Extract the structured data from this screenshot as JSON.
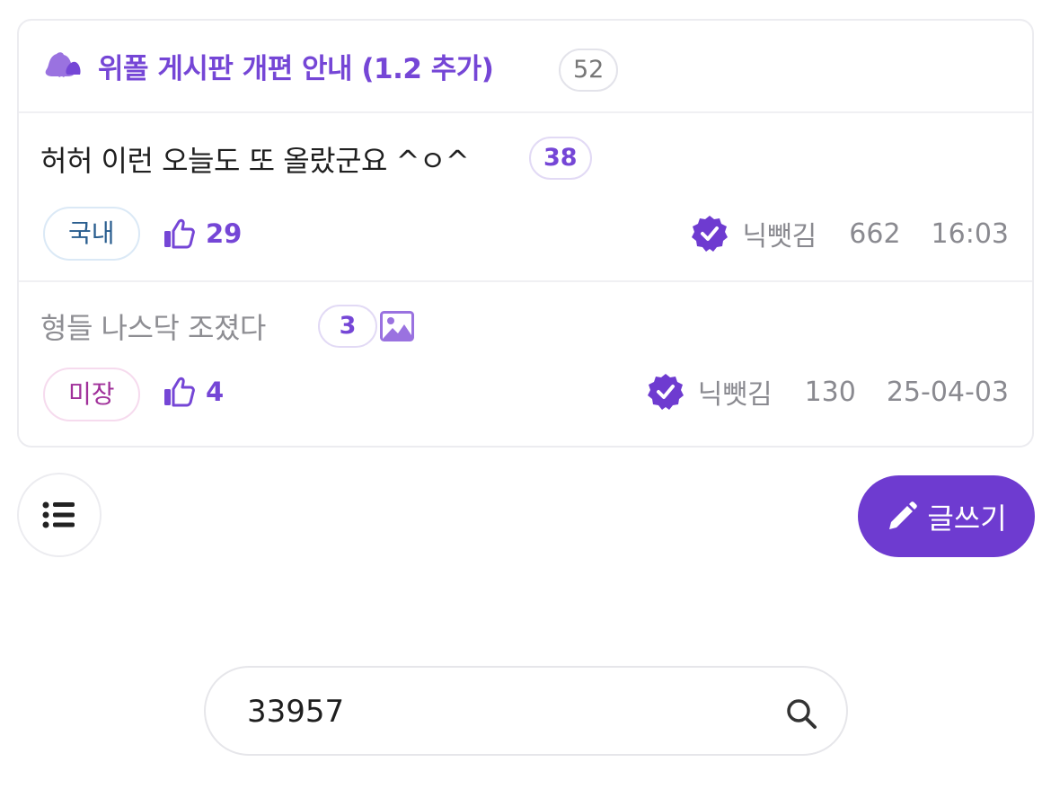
{
  "notice": {
    "icon": "bell-icon",
    "title": "위폴 게시판 개편 안내 (1.2 추가)",
    "comment_count": "52"
  },
  "posts": [
    {
      "title": "허허 이런 오늘도 또 올랐군요 ^ㅇ^",
      "comment_count": "38",
      "has_image": false,
      "category": "국내",
      "likes": "29",
      "author": "닉뺏김",
      "views": "662",
      "time": "16:03"
    },
    {
      "title": "형들 나스닥 조졌다",
      "comment_count": "3",
      "has_image": true,
      "category": "미장",
      "likes": "4",
      "author": "닉뺏김",
      "views": "130",
      "time": "25-04-03"
    }
  ],
  "actions": {
    "list_icon": "list-icon",
    "write_label": "글쓰기",
    "write_icon": "pencil-icon"
  },
  "search": {
    "value": "33957",
    "icon": "search-icon"
  },
  "colors": {
    "accent": "#7546d6",
    "write_button": "#6e3bd0",
    "tag_domestic": "#2a5e8f",
    "tag_us": "#a0309a"
  }
}
